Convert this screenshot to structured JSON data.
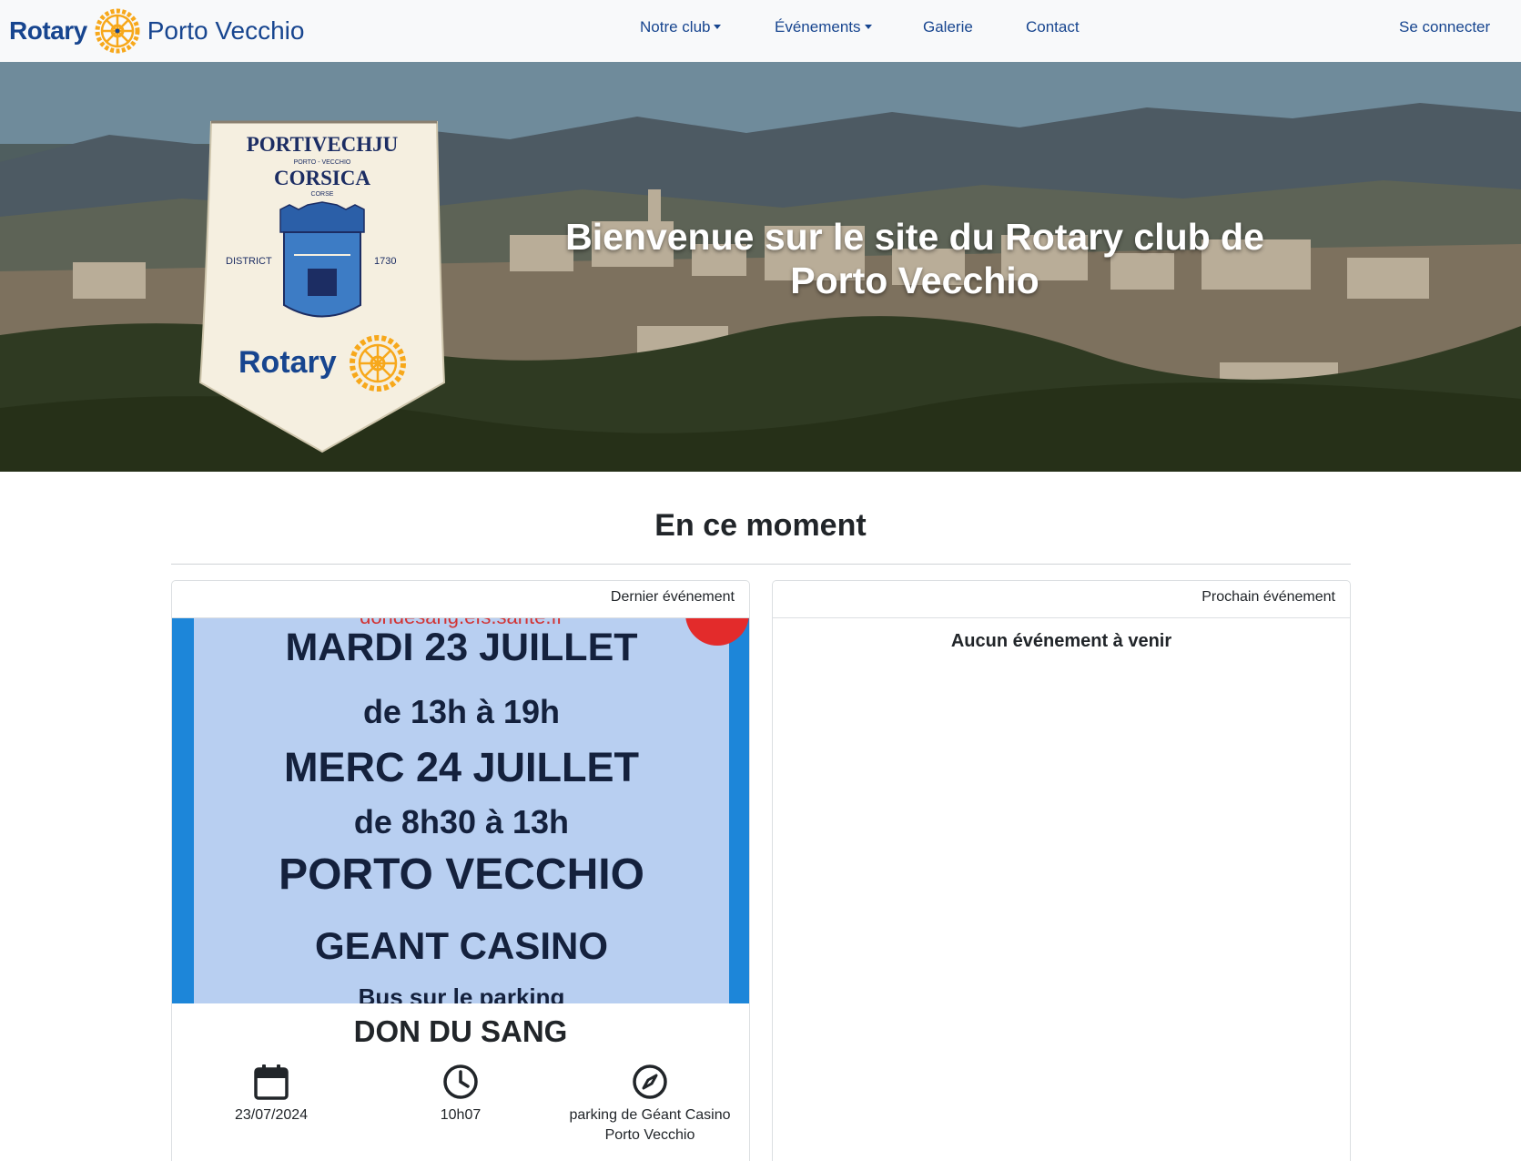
{
  "brand": {
    "left": "Rotary",
    "right": "Porto Vecchio",
    "wheel_icon": "rotary-wheel-icon"
  },
  "nav": {
    "items": [
      {
        "label": "Notre club",
        "dropdown": true
      },
      {
        "label": "Événements",
        "dropdown": true
      },
      {
        "label": "Galerie",
        "dropdown": false
      },
      {
        "label": "Contact",
        "dropdown": false
      }
    ],
    "login": "Se connecter"
  },
  "hero": {
    "title": "Bienvenue sur le site du Rotary club de Porto Vecchio",
    "pennant": {
      "line1": "PORTIVECHJU",
      "line2": "PORTO - VECCHIO",
      "line3": "CORSICA",
      "line4": "CORSE",
      "district_label": "DISTRICT",
      "district_number": "1730",
      "rotary": "Rotary"
    }
  },
  "section": {
    "title": "En ce moment"
  },
  "last_event": {
    "header": "Dernier événement",
    "poster": {
      "url": "dondesang.efs.sante.fr",
      "lines": [
        "MARDI 23 JUILLET",
        "de 13h à 19h",
        "MERC 24 JUILLET",
        "de 8h30 à 13h",
        "PORTO VECCHIO",
        "GEANT CASINO",
        "Bus sur le parking"
      ]
    },
    "title": "DON DU SANG",
    "date": "23/07/2024",
    "time": "10h07",
    "location": "parking de Géant Casino Porto Vecchio"
  },
  "next_event": {
    "header": "Prochain événement",
    "empty": "Aucun événement à venir"
  },
  "colors": {
    "brand_blue": "#17458f",
    "rotary_gold": "#f7a81b",
    "navbar_bg": "#f8f9fa"
  }
}
